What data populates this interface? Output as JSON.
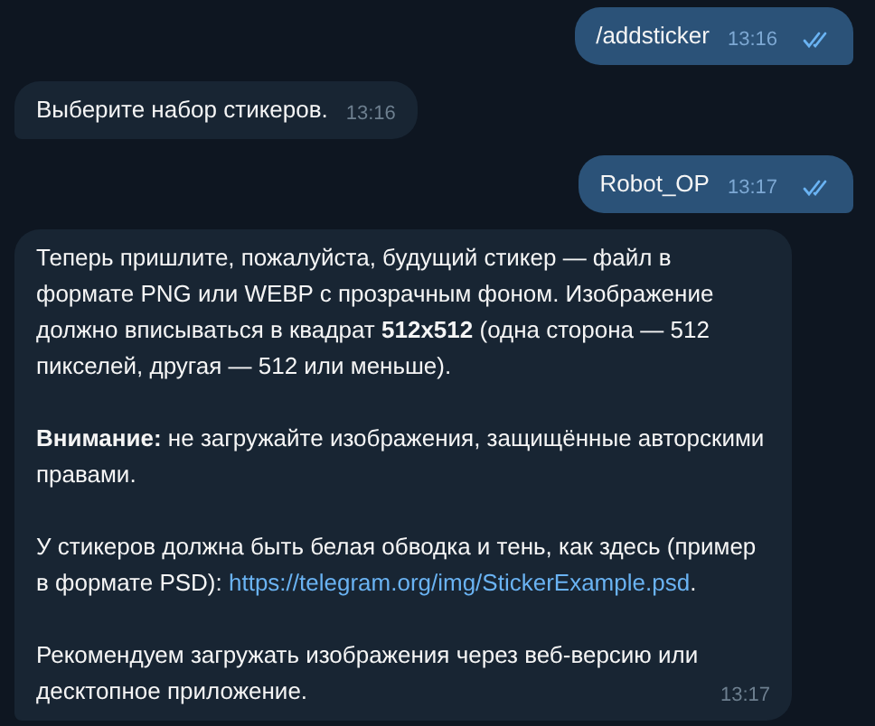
{
  "messages": [
    {
      "kind": "outgoing",
      "paragraphs": [
        [
          {
            "kind": "text",
            "text": "/addsticker"
          }
        ]
      ],
      "time": "13:16",
      "read": true
    },
    {
      "kind": "incoming",
      "paragraphs": [
        [
          {
            "kind": "text",
            "text": "Выберите набор стикеров."
          }
        ]
      ],
      "time": "13:16"
    },
    {
      "kind": "outgoing",
      "paragraphs": [
        [
          {
            "kind": "text",
            "text": "Robot_OP"
          }
        ]
      ],
      "time": "13:17",
      "read": true
    },
    {
      "kind": "incoming",
      "paragraphs": [
        [
          {
            "kind": "text",
            "text": "Теперь пришлите, пожалуйста, будущий стикер — файл в формате PNG или WEBP с прозрачным фоном. Изображение должно вписываться в квадрат **512x512** (одна сторона — 512 пикселей, другая — 512 или меньше)."
          }
        ],
        [
          {
            "kind": "text",
            "text": "**Внимание:** не загружайте изображения, защищённые авторскими правами."
          }
        ],
        [
          {
            "kind": "text",
            "text": "У стикеров должна быть белая обводка и тень, как здесь (пример в формате PSD): "
          },
          {
            "kind": "link",
            "text": "https://telegram.org/img/StickerExample.psd"
          },
          {
            "kind": "text",
            "text": "."
          }
        ],
        [
          {
            "kind": "text",
            "text": "Рекомендуем загружать изображения через веб-версию или десктопное приложение."
          }
        ]
      ],
      "time": "13:17"
    }
  ]
}
